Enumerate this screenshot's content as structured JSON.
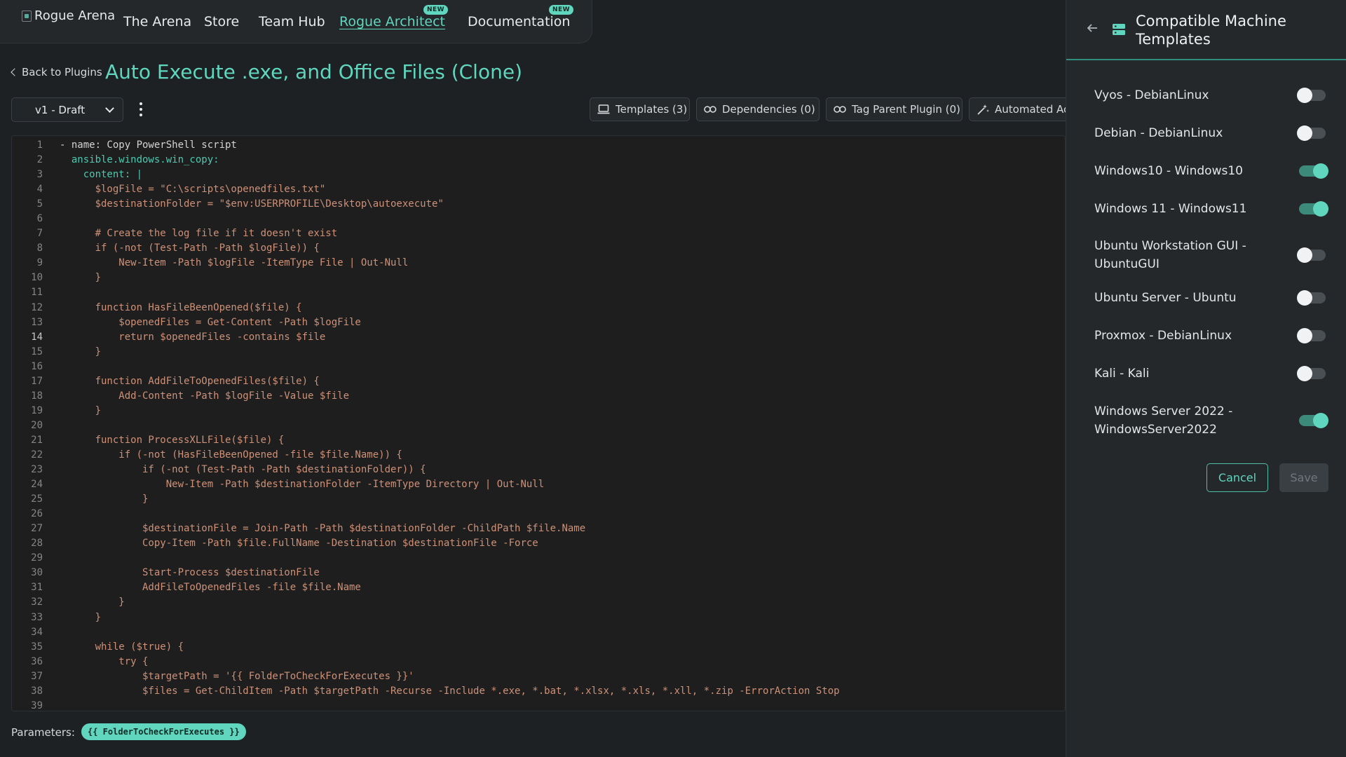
{
  "nav": {
    "logo_alt": "Rogue Arena",
    "items": [
      {
        "label": "The Arena"
      },
      {
        "label": "Store"
      },
      {
        "label": "Team Hub"
      },
      {
        "label": "Rogue Architect",
        "badge": "NEW",
        "active": true
      },
      {
        "label": "Documentation",
        "badge": "NEW"
      }
    ]
  },
  "header": {
    "back_label": "Back to Plugins",
    "title": "Auto Execute .exe, and Office Files (Clone)"
  },
  "version": {
    "selected": "v1 - Draft"
  },
  "toolbar": {
    "templates": "Templates (3)",
    "dependencies": "Dependencies (0)",
    "tag_parent": "Tag Parent Plugin (0)",
    "automated": "Automated Ac"
  },
  "editor": {
    "current_line": 14,
    "lines": [
      "- name: Copy PowerShell script",
      "  ansible.windows.win_copy:",
      "    content: |",
      "      $logFile = \"C:\\scripts\\openedfiles.txt\"",
      "      $destinationFolder = \"$env:USERPROFILE\\Desktop\\autoexecute\"",
      "",
      "      # Create the log file if it doesn't exist",
      "      if (-not (Test-Path -Path $logFile)) {",
      "          New-Item -Path $logFile -ItemType File | Out-Null",
      "      }",
      "",
      "      function HasFileBeenOpened($file) {",
      "          $openedFiles = Get-Content -Path $logFile",
      "          return $openedFiles -contains $file",
      "      }",
      "",
      "      function AddFileToOpenedFiles($file) {",
      "          Add-Content -Path $logFile -Value $file",
      "      }",
      "",
      "      function ProcessXLLFile($file) {",
      "          if (-not (HasFileBeenOpened -file $file.Name)) {",
      "              if (-not (Test-Path -Path $destinationFolder)) {",
      "                  New-Item -Path $destinationFolder -ItemType Directory | Out-Null",
      "              }",
      "",
      "              $destinationFile = Join-Path -Path $destinationFolder -ChildPath $file.Name",
      "              Copy-Item -Path $file.FullName -Destination $destinationFile -Force",
      "",
      "              Start-Process $destinationFile",
      "              AddFileToOpenedFiles -file $file.Name",
      "          }",
      "      }",
      "",
      "      while ($true) {",
      "          try {",
      "              $targetPath = '{{ FolderToCheckForExecutes }}'",
      "              $files = Get-ChildItem -Path $targetPath -Recurse -Include *.exe, *.bat, *.xlsx, *.xls, *.xll, *.zip -ErrorAction Stop",
      ""
    ]
  },
  "parameters": {
    "label": "Parameters:",
    "items": [
      "{{ FolderToCheckForExecutes }}"
    ]
  },
  "panel": {
    "title": "Compatible Machine Templates",
    "templates": [
      {
        "label": "Vyos - DebianLinux",
        "enabled": false
      },
      {
        "label": "Debian - DebianLinux",
        "enabled": false
      },
      {
        "label": "Windows10 - Windows10",
        "enabled": true
      },
      {
        "label": "Windows 11 - Windows11",
        "enabled": true
      },
      {
        "label": "Ubuntu Workstation GUI - UbuntuGUI",
        "enabled": false
      },
      {
        "label": "Ubuntu Server - Ubuntu",
        "enabled": false
      },
      {
        "label": "Proxmox - DebianLinux",
        "enabled": false
      },
      {
        "label": "Kali - Kali",
        "enabled": false
      },
      {
        "label": "Windows Server 2022 - WindowsServer2022",
        "enabled": true
      }
    ],
    "cancel_label": "Cancel",
    "save_label": "Save"
  },
  "colors": {
    "accent": "#5fd6bd",
    "background": "#1e2124",
    "panel": "#24282b"
  }
}
